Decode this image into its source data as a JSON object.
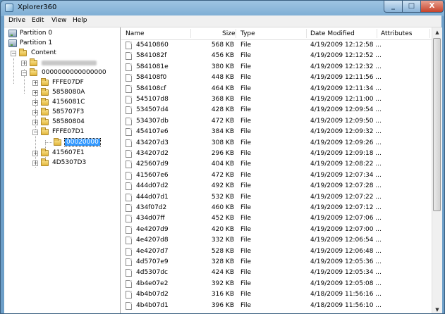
{
  "window": {
    "title": "Xplorer360",
    "minimize_label": "_",
    "maximize_label": "□",
    "close_label": "X"
  },
  "menu": [
    "Drive",
    "Edit",
    "View",
    "Help"
  ],
  "tree": {
    "partition0": "Partition 0",
    "partition1": "Partition 1",
    "content": "Content",
    "profile": "0000000000000000",
    "children": [
      "FFFE07DF",
      "5858080A",
      "4156081C",
      "585707F3",
      "58580804",
      "FFFE07D1"
    ],
    "selected": "00020000",
    "after": [
      "415607E1",
      "4D5307D3"
    ],
    "expander_plus": "+",
    "expander_minus": "−"
  },
  "columns": {
    "name": "Name",
    "size": "Size",
    "type": "Type",
    "date": "Date Modified",
    "attributes": "Attributes"
  },
  "files": [
    {
      "name": "45410860",
      "size": "568 KB",
      "type": "File",
      "date": "4/19/2009 12:12:58 ..."
    },
    {
      "name": "5841082f",
      "size": "456 KB",
      "type": "File",
      "date": "4/19/2009 12:12:52 ..."
    },
    {
      "name": "5841081e",
      "size": "380 KB",
      "type": "File",
      "date": "4/19/2009 12:12:32 ..."
    },
    {
      "name": "584108f0",
      "size": "448 KB",
      "type": "File",
      "date": "4/19/2009 12:11:56 ..."
    },
    {
      "name": "584108cf",
      "size": "464 KB",
      "type": "File",
      "date": "4/19/2009 12:11:34 ..."
    },
    {
      "name": "545107d8",
      "size": "368 KB",
      "type": "File",
      "date": "4/19/2009 12:11:00 ..."
    },
    {
      "name": "534507d4",
      "size": "428 KB",
      "type": "File",
      "date": "4/19/2009 12:09:54 ..."
    },
    {
      "name": "534307db",
      "size": "472 KB",
      "type": "File",
      "date": "4/19/2009 12:09:50 ..."
    },
    {
      "name": "454107e6",
      "size": "384 KB",
      "type": "File",
      "date": "4/19/2009 12:09:32 ..."
    },
    {
      "name": "434207d3",
      "size": "308 KB",
      "type": "File",
      "date": "4/19/2009 12:09:26 ..."
    },
    {
      "name": "434207d2",
      "size": "296 KB",
      "type": "File",
      "date": "4/19/2009 12:09:18 ..."
    },
    {
      "name": "425607d9",
      "size": "404 KB",
      "type": "File",
      "date": "4/19/2009 12:08:22 ..."
    },
    {
      "name": "415607e6",
      "size": "472 KB",
      "type": "File",
      "date": "4/19/2009 12:07:34 ..."
    },
    {
      "name": "444d07d2",
      "size": "492 KB",
      "type": "File",
      "date": "4/19/2009 12:07:28 ..."
    },
    {
      "name": "444d07d1",
      "size": "532 KB",
      "type": "File",
      "date": "4/19/2009 12:07:22 ..."
    },
    {
      "name": "434f07d2",
      "size": "460 KB",
      "type": "File",
      "date": "4/19/2009 12:07:12 ..."
    },
    {
      "name": "434d07ff",
      "size": "452 KB",
      "type": "File",
      "date": "4/19/2009 12:07:06 ..."
    },
    {
      "name": "4e4207d9",
      "size": "420 KB",
      "type": "File",
      "date": "4/19/2009 12:07:00 ..."
    },
    {
      "name": "4e4207d8",
      "size": "332 KB",
      "type": "File",
      "date": "4/19/2009 12:06:54 ..."
    },
    {
      "name": "4e4207d7",
      "size": "528 KB",
      "type": "File",
      "date": "4/19/2009 12:06:48 ..."
    },
    {
      "name": "4d5707e9",
      "size": "328 KB",
      "type": "File",
      "date": "4/19/2009 12:05:36 ..."
    },
    {
      "name": "4d5307dc",
      "size": "424 KB",
      "type": "File",
      "date": "4/19/2009 12:05:34 ..."
    },
    {
      "name": "4b4e07e2",
      "size": "392 KB",
      "type": "File",
      "date": "4/19/2009 12:05:08 ..."
    },
    {
      "name": "4b4b07d2",
      "size": "316 KB",
      "type": "File",
      "date": "4/18/2009 11:56:16 ..."
    },
    {
      "name": "4b4b07d1",
      "size": "396 KB",
      "type": "File",
      "date": "4/18/2009 11:56:10 ..."
    }
  ],
  "scrollbar": {
    "up": "▲",
    "down": "▼"
  }
}
